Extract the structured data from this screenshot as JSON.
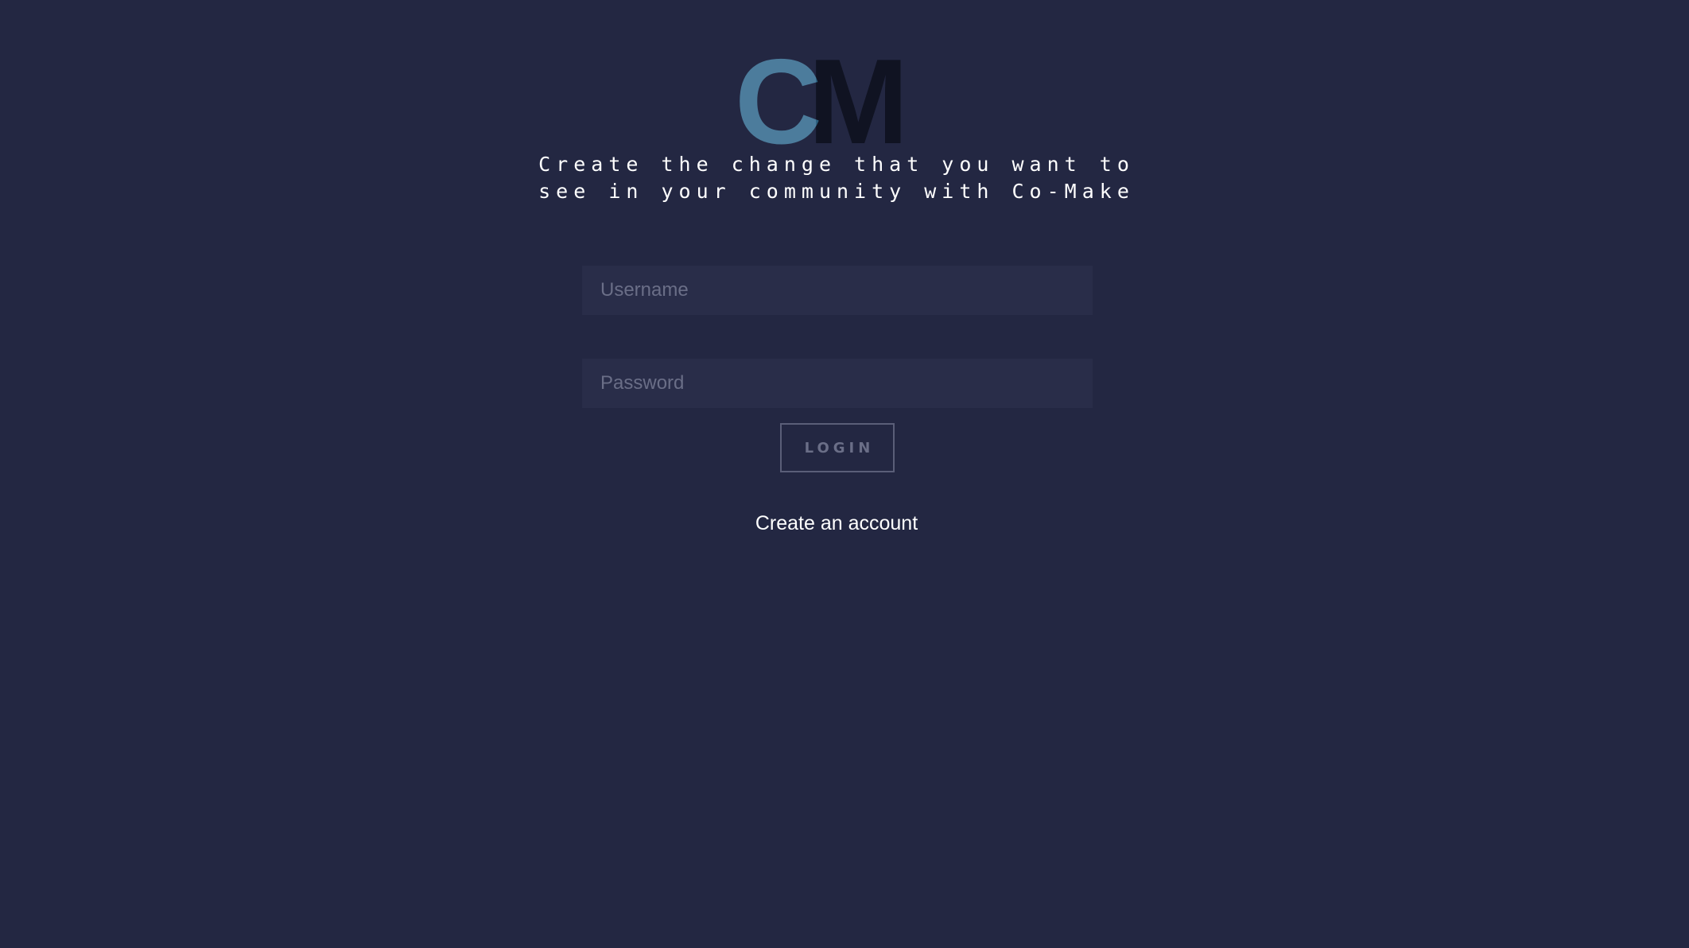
{
  "logo": {
    "letter_1": "C",
    "letter_2": "M",
    "colors": {
      "c_letter": "#4c7c9c",
      "c_overlap": "#2a5e7d",
      "m_letter": "#101322"
    }
  },
  "tagline": {
    "line_1": "Create the change that you want to",
    "line_2": "see in your community with Co-Make"
  },
  "form": {
    "username": {
      "placeholder": "Username",
      "value": ""
    },
    "password": {
      "placeholder": "Password",
      "value": ""
    },
    "login_label": "LOGIN"
  },
  "create_account_label": "Create an account",
  "colors": {
    "background": "#232742",
    "input_background": "#292d49",
    "placeholder_text": "#6a6e87",
    "button_border": "#5a5e78",
    "text": "#ffffff"
  }
}
